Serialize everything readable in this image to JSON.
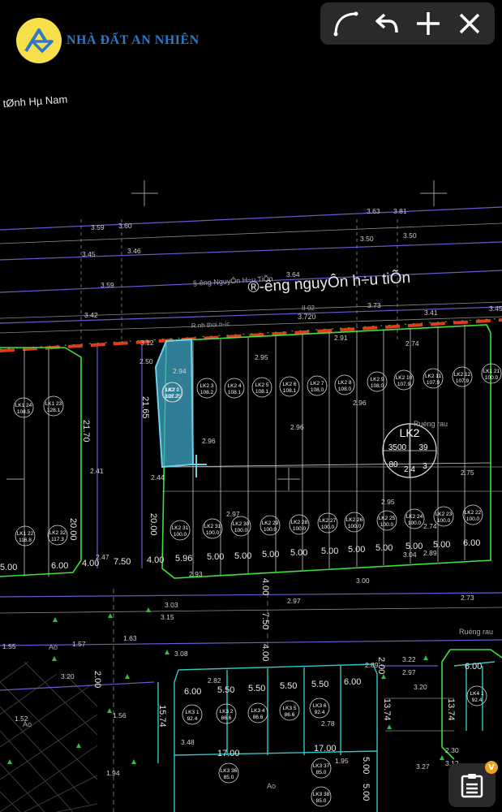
{
  "brand": {
    "name": "NHÀ ĐẤT AN NHIÊN"
  },
  "toolbar": {
    "icons": [
      "curve-tool-icon",
      "undo-icon",
      "add-icon",
      "close-icon"
    ]
  },
  "fab": {
    "icon": "clipboard-list-icon",
    "badge": "V"
  },
  "map": {
    "province_label": "tØnh Hµ Nam",
    "road_label_large": "®-êng nguyÔn h÷u tiÕn",
    "road_label_small": "§-êng NguyÔn H÷u TiÕn",
    "red_line_label": "R nh thoi n-íc",
    "block_code": "II-02",
    "block_code_elev": "3.720",
    "field_label_1": "Ruéng rau",
    "field_label_2": "Ruéng rau",
    "ao_1": "Ao",
    "ao_2": "Ao",
    "ao_3": "Ao",
    "lk2_marker": {
      "name": "LK2",
      "v1": "3500",
      "v2": "39",
      "v3": "80",
      "v4": "2.4",
      "v5": "3"
    },
    "elevations": {
      "e1": "3.59",
      "e2": "3.60",
      "e3": "3.63",
      "e4": "3.81",
      "e5": "3.45",
      "e6": "3.46",
      "e7": "3.50",
      "e8": "3.50",
      "e9": "3.59",
      "e10": "3.64",
      "e11": "3.42",
      "e12": "3.73",
      "e13": "3.41",
      "e14": "3.45",
      "e15": "3.12",
      "e16": "2.91",
      "e17": "2.50",
      "e18": "2.74",
      "e19": "2.95",
      "e20": "2.96",
      "e21": "2.96",
      "e22": "2.96",
      "e23": "2.41",
      "e24": "2.75",
      "e25": "2.44",
      "e26": "2.97",
      "e27": "2.95",
      "e28": "2.74",
      "e29": "2.47",
      "e30": "3.04",
      "e31": "2.89",
      "e32": "2.93",
      "e33": "3.00",
      "e34": "2.97",
      "e35": "2.73",
      "e36": "3.03",
      "e37": "3.15",
      "e38": "1.57",
      "e39": "1.63",
      "e40": "3.08",
      "e41": "3.20",
      "e42": "2.82",
      "e43": "2.89",
      "e44": "3.22",
      "e45": "2.97",
      "e46": "3.20",
      "e47": "1.52",
      "e48": "1.56",
      "e49": "3.48",
      "e50": "2.78",
      "e51": "1.95",
      "e52": "1.94",
      "e53": "3.27",
      "e54": "2.30",
      "e55": "3.12",
      "e56": "2.94",
      "e57": "1.55"
    },
    "dims": {
      "d1": "21.70",
      "d2": "21.65",
      "d3": "20.00",
      "d4": "20.00",
      "d5": "5.00",
      "d6": "6.00",
      "d7": "4.00",
      "d8": "7.50",
      "d9": "4.00",
      "d10": "5.96",
      "d11": "5.00",
      "d12": "5.00",
      "d13": "5.00",
      "d14": "5.00",
      "d15": "5.00",
      "d16": "5.00",
      "d17": "5.00",
      "d18": "5.00",
      "d19": "5.00",
      "d20": "6.00",
      "d21": "4.00",
      "d22": "7.50",
      "d23": "4.00",
      "d24": "2.00",
      "d25": "2.00",
      "d26": "13.74",
      "d27": "15.74",
      "d28": "6.00",
      "d29": "5.50",
      "d30": "5.50",
      "d31": "5.50",
      "d32": "5.50",
      "d33": "6.00",
      "d34": "17.00",
      "d35": "17.00",
      "d36": "5.00",
      "d37": "5.00",
      "d38": "6.00",
      "d39": "13.74",
      "d40": "5.00"
    },
    "lots": [
      {
        "code": "LK1",
        "num": "24",
        "area": "108.5"
      },
      {
        "code": "LK1",
        "num": "23",
        "area": "128.1"
      },
      {
        "code": "LK2",
        "num": "1",
        "area": "127.7"
      },
      {
        "code": "LK2",
        "num": "2",
        "area": "108.25"
      },
      {
        "code": "LK2",
        "num": "3",
        "area": "108.2"
      },
      {
        "code": "LK2",
        "num": "4",
        "area": "108.1"
      },
      {
        "code": "LK2",
        "num": "5",
        "area": "108.1"
      },
      {
        "code": "LK2",
        "num": "6",
        "area": "108.1"
      },
      {
        "code": "LK2",
        "num": "7",
        "area": "108.0"
      },
      {
        "code": "LK2",
        "num": "8",
        "area": "108.0"
      },
      {
        "code": "LK2",
        "num": "9",
        "area": "108.0"
      },
      {
        "code": "LK2",
        "num": "10",
        "area": "107.9"
      },
      {
        "code": "LK2",
        "num": "11",
        "area": "107.9"
      },
      {
        "code": "LK2",
        "num": "12",
        "area": "107.9"
      },
      {
        "code": "LK1",
        "num": "21",
        "area": "100.0"
      },
      {
        "code": "LK1",
        "num": "22",
        "area": "116.8"
      },
      {
        "code": "LK2",
        "num": "32",
        "area": "117.3"
      },
      {
        "code": "LK2",
        "num": "31",
        "area": "100.0"
      },
      {
        "code": "LK2",
        "num": "31",
        "area": "100.0"
      },
      {
        "code": "LK2",
        "num": "30",
        "area": "100.0"
      },
      {
        "code": "LK2",
        "num": "29",
        "area": "100.0"
      },
      {
        "code": "LK2",
        "num": "28",
        "area": "100.0"
      },
      {
        "code": "LK2",
        "num": "27",
        "area": "100.0"
      },
      {
        "code": "LK2",
        "num": "26",
        "area": "100.0"
      },
      {
        "code": "LK2",
        "num": "25",
        "area": "100.0"
      },
      {
        "code": "LK2",
        "num": "24",
        "area": "100.0"
      },
      {
        "code": "LK2",
        "num": "23",
        "area": "100.0"
      },
      {
        "code": "LK2",
        "num": "22",
        "area": "100.0"
      },
      {
        "code": "LK3",
        "num": "1",
        "area": "92.4"
      },
      {
        "code": "LK3",
        "num": "2",
        "area": "86.6"
      },
      {
        "code": "LK3",
        "num": "4",
        "area": "86.6"
      },
      {
        "code": "LK3",
        "num": "5",
        "area": "86.6"
      },
      {
        "code": "LK3",
        "num": "6",
        "area": "92.4"
      },
      {
        "code": "LK4",
        "num": "1",
        "area": "92.4"
      },
      {
        "code": "LK3",
        "num": "36",
        "area": "85.0"
      },
      {
        "code": "LK3",
        "num": "37",
        "area": "85.0"
      },
      {
        "code": "LK3",
        "num": "38",
        "area": "85.0"
      }
    ]
  }
}
